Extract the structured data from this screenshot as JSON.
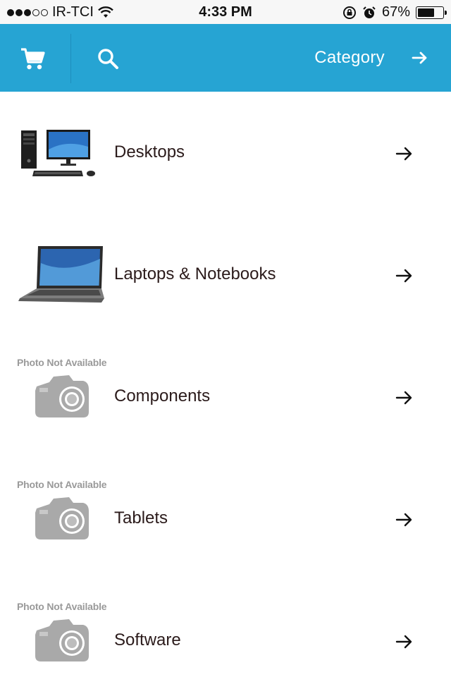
{
  "status_bar": {
    "carrier": "IR-TCI",
    "time": "4:33 PM",
    "battery_text": "67%",
    "battery_level": 0.67
  },
  "header": {
    "title": "Category",
    "color": "#26a4d3"
  },
  "photo_na_text": "Photo Not Available",
  "categories": [
    {
      "label": "Desktops",
      "image": "desktop-computer"
    },
    {
      "label": "Laptops & Notebooks",
      "image": "laptop"
    },
    {
      "label": "Components",
      "image": "photo-not-available"
    },
    {
      "label": "Tablets",
      "image": "photo-not-available"
    },
    {
      "label": "Software",
      "image": "photo-not-available"
    }
  ]
}
